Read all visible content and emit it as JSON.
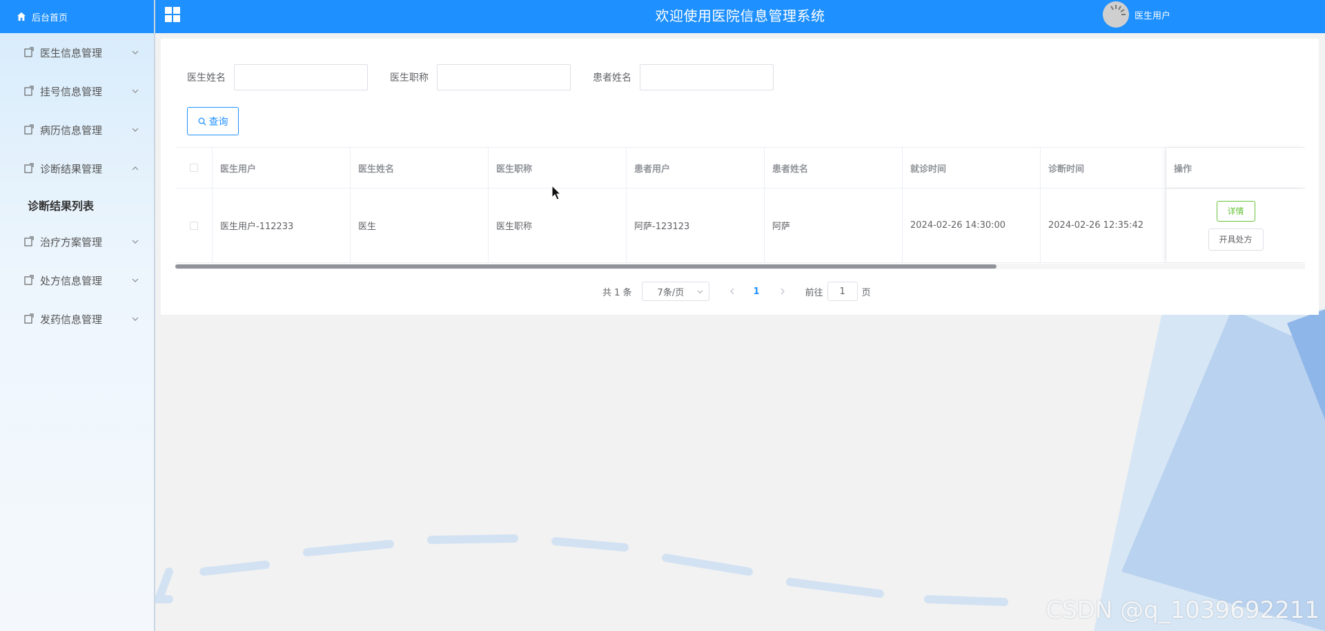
{
  "header": {
    "title": "欢迎使用医院信息管理系统",
    "user_name": "医生用户"
  },
  "sidebar": {
    "home_label": "后台首页",
    "items": [
      {
        "label": "医生信息管理"
      },
      {
        "label": "挂号信息管理"
      },
      {
        "label": "病历信息管理"
      },
      {
        "label": "诊断结果管理",
        "expanded": true
      },
      {
        "label": "治疗方案管理"
      },
      {
        "label": "处方信息管理"
      },
      {
        "label": "发药信息管理"
      }
    ],
    "submenu": {
      "label": "诊断结果列表"
    }
  },
  "search": {
    "fields": [
      {
        "label": "医生姓名",
        "value": ""
      },
      {
        "label": "医生职称",
        "value": ""
      },
      {
        "label": "患者姓名",
        "value": ""
      }
    ],
    "query_label": "查询"
  },
  "table": {
    "columns": [
      "医生用户",
      "医生姓名",
      "医生职称",
      "患者用户",
      "患者姓名",
      "就诊时间",
      "诊断时间",
      "操作"
    ],
    "rows": [
      {
        "cells": [
          "医生用户-112233",
          "医生",
          "医生职称",
          "阿萨-123123",
          "阿萨",
          "2024-02-26 14:30:00",
          "2024-02-26 12:35:42"
        ],
        "detail_label": "详情",
        "prescribe_label": "开具处方"
      }
    ]
  },
  "pagination": {
    "total_text": "共 1 条",
    "page_size": "7条/页",
    "current_page": "1",
    "goto_prefix": "前往",
    "goto_value": "1",
    "goto_suffix": "页"
  },
  "watermark": "CSDN @q_1039692211",
  "colors": {
    "accent": "#1e90ff",
    "success": "#67c23a"
  }
}
